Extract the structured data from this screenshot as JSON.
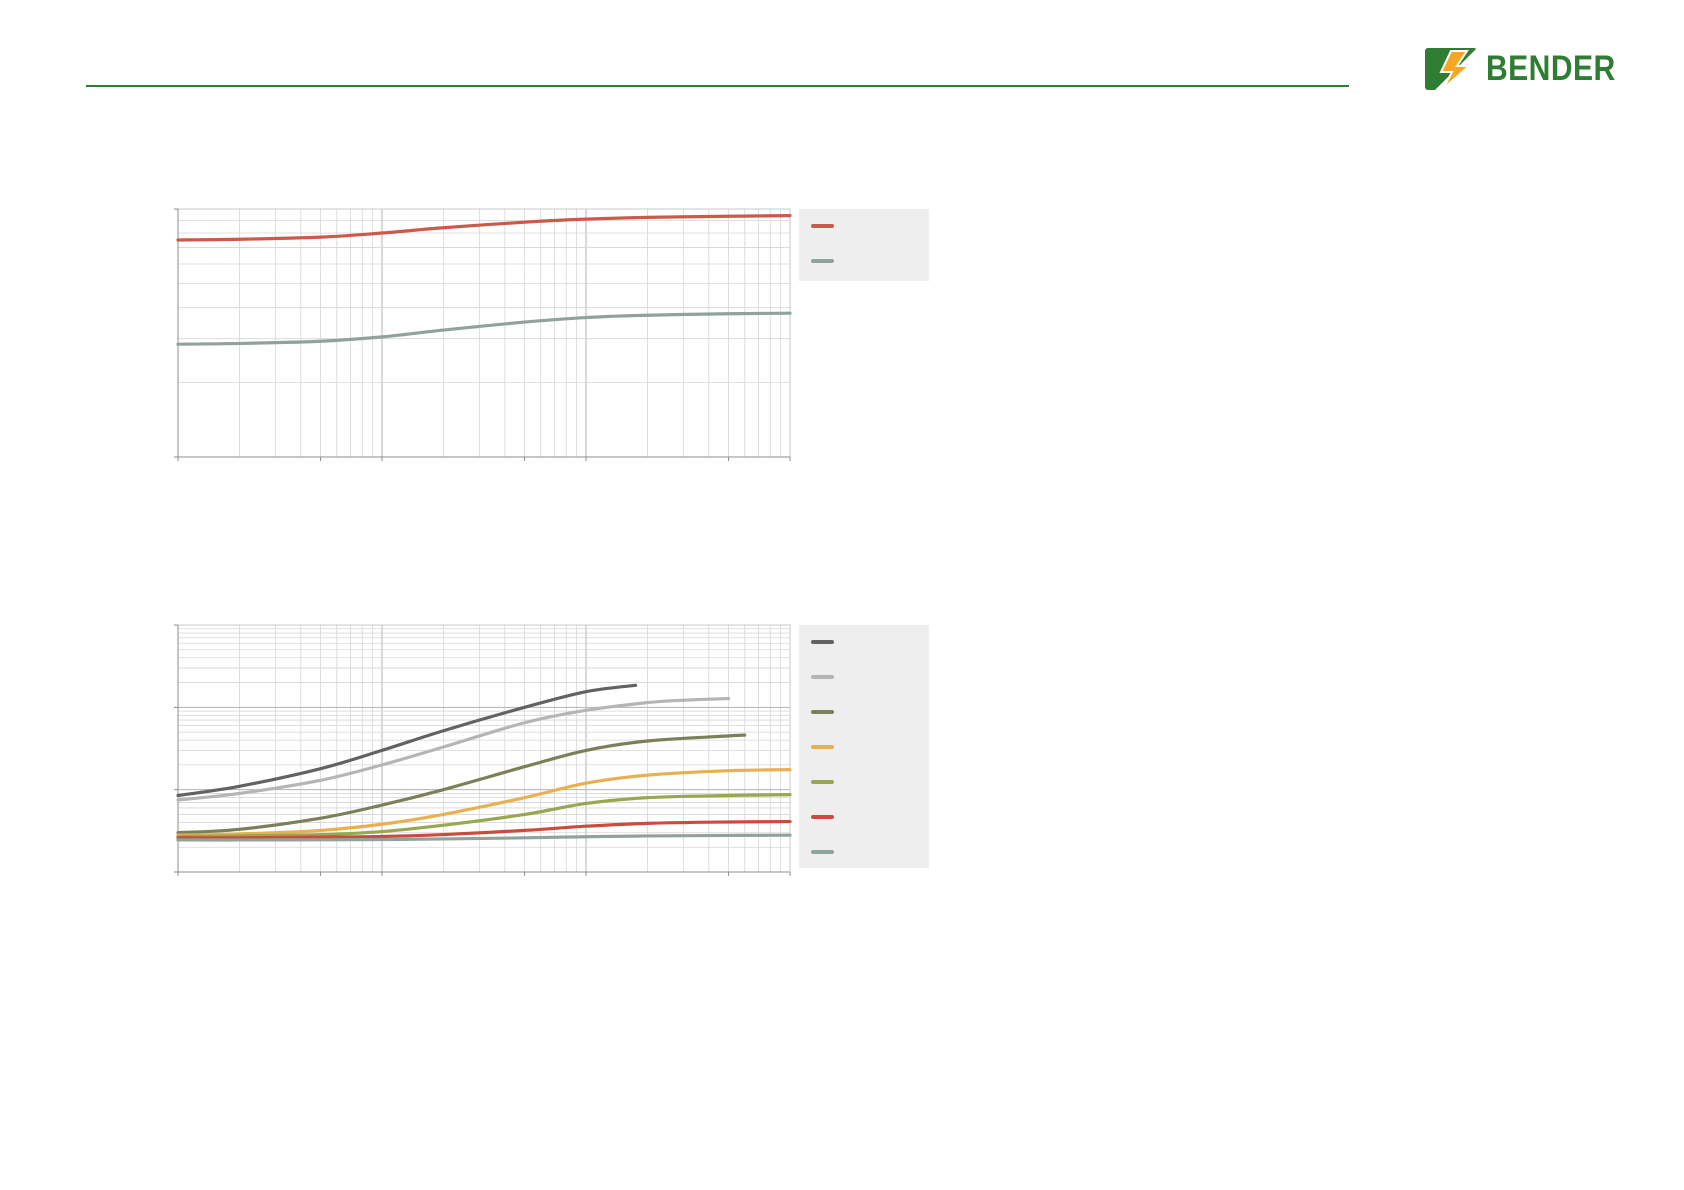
{
  "brand": {
    "name": "BENDER",
    "primary_color": "#2e7d32",
    "logo_orange": "#f5a623",
    "rule_color": "#2e7d32"
  },
  "chart_data": [
    {
      "type": "line",
      "x_scale": "log",
      "y_scale": "log",
      "xlim": [
        10,
        10000
      ],
      "ylim": [
        10,
        100
      ],
      "grid": true,
      "legend_position": "right",
      "x": [
        10,
        20,
        50,
        100,
        200,
        500,
        1000,
        2000,
        5000,
        10000
      ],
      "series": [
        {
          "color": "#cc5a4a",
          "values": [
            75,
            75.5,
            77,
            80,
            84,
            88.5,
            91,
            92.5,
            93.5,
            94
          ]
        },
        {
          "color": "#8fa39b",
          "values": [
            28.5,
            28.7,
            29.3,
            30.5,
            32.5,
            35,
            36.5,
            37.3,
            37.8,
            38
          ]
        }
      ]
    },
    {
      "type": "line",
      "x_scale": "log",
      "y_scale": "log",
      "xlim": [
        10,
        10000
      ],
      "ylim": [
        0.1,
        100
      ],
      "grid": true,
      "legend_position": "right",
      "x": [
        10,
        20,
        50,
        100,
        200,
        500,
        1000,
        2000,
        5000,
        10000
      ],
      "series": [
        {
          "color": "#626262",
          "x": [
            10,
            20,
            50,
            100,
            200,
            500,
            1000,
            1750
          ],
          "values": [
            0.85,
            1.1,
            1.8,
            3.0,
            5.2,
            10.0,
            15.5,
            18.5
          ]
        },
        {
          "color": "#b4b6b6",
          "x": [
            10,
            20,
            50,
            100,
            200,
            500,
            1000,
            2000,
            3000,
            5000
          ],
          "values": [
            0.75,
            0.9,
            1.3,
            2.0,
            3.3,
            6.5,
            9.2,
            11.4,
            12.2,
            12.8
          ]
        },
        {
          "color": "#7c7f58",
          "x": [
            10,
            20,
            50,
            100,
            200,
            500,
            1000,
            2000,
            5000,
            6000
          ],
          "values": [
            0.3,
            0.33,
            0.45,
            0.65,
            1.0,
            1.9,
            3.0,
            3.9,
            4.5,
            4.6
          ]
        },
        {
          "color": "#e8b050",
          "x": [
            10,
            20,
            50,
            100,
            200,
            500,
            1000,
            2000,
            5000,
            10000
          ],
          "values": [
            0.28,
            0.29,
            0.32,
            0.38,
            0.5,
            0.8,
            1.2,
            1.5,
            1.7,
            1.75
          ]
        },
        {
          "color": "#9aa750",
          "x": [
            10,
            20,
            50,
            100,
            200,
            500,
            1000,
            2000,
            5000,
            10000
          ],
          "values": [
            0.27,
            0.275,
            0.285,
            0.31,
            0.37,
            0.5,
            0.68,
            0.8,
            0.85,
            0.87
          ]
        },
        {
          "color": "#cc4b3f",
          "x": [
            10,
            20,
            50,
            100,
            200,
            500,
            1000,
            2000,
            5000,
            10000
          ],
          "values": [
            0.26,
            0.26,
            0.265,
            0.27,
            0.285,
            0.32,
            0.36,
            0.39,
            0.405,
            0.41
          ]
        },
        {
          "color": "#8fa39b",
          "x": [
            10,
            20,
            50,
            100,
            200,
            500,
            1000,
            2000,
            5000,
            10000
          ],
          "values": [
            0.245,
            0.245,
            0.246,
            0.248,
            0.252,
            0.26,
            0.268,
            0.274,
            0.278,
            0.28
          ]
        }
      ]
    }
  ]
}
